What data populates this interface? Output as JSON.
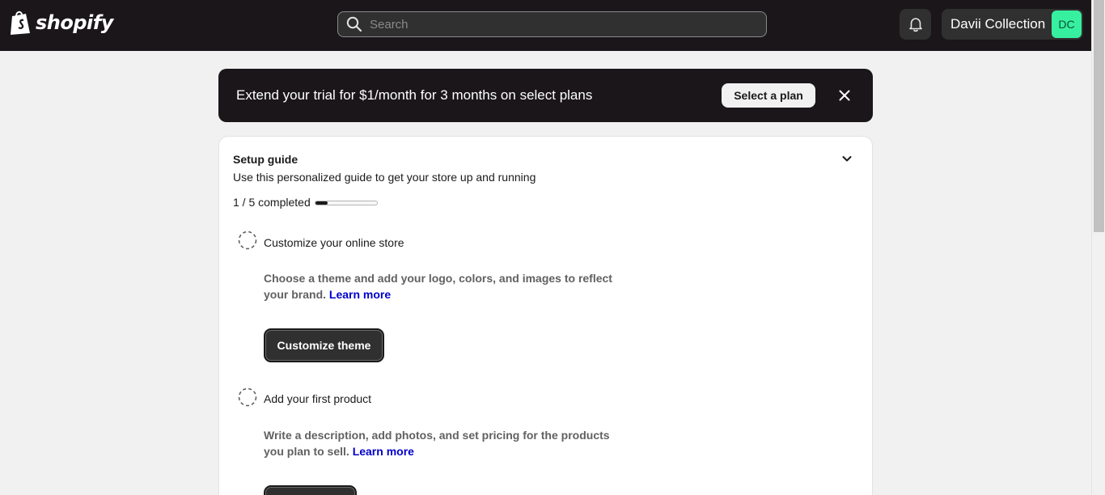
{
  "header": {
    "brand": "shopify",
    "search_placeholder": "Search",
    "store_name": "Davii Collection",
    "avatar_initials": "DC"
  },
  "banner": {
    "text": "Extend your trial for $1/month for 3 months on select plans",
    "button_label": "Select a plan"
  },
  "setup_guide": {
    "title": "Setup guide",
    "subtitle": "Use this personalized guide to get your store up and running",
    "progress_label": "1 / 5 completed",
    "progress_fraction": 0.2,
    "tasks": [
      {
        "title": "Customize your online store",
        "description": "Choose a theme and add your logo, colors, and images to reflect your brand.",
        "link": "Learn more",
        "button": "Customize theme"
      },
      {
        "title": "Add your first product",
        "description": "Write a description, add photos, and set pricing for the products you plan to sell.",
        "link": "Learn more",
        "button": ""
      }
    ]
  },
  "colors": {
    "topbar": "#1a1619",
    "avatar": "#36f0a0",
    "link": "#0000cc"
  },
  "icons": [
    "shopify-bag-icon",
    "search-icon",
    "bell-icon",
    "close-icon",
    "chevron-down-icon",
    "dashed-circle-icon"
  ]
}
